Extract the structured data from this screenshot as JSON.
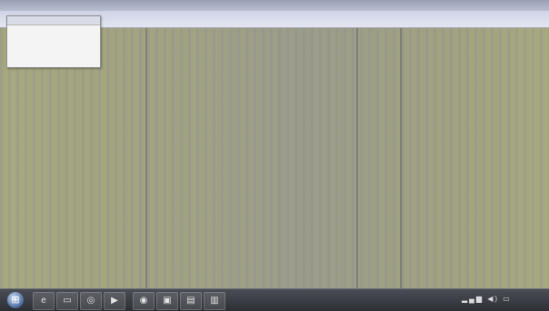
{
  "window": {
    "title": "",
    "menu_label": ""
  },
  "popup": {
    "header": "",
    "rows": [
      {
        "key": "",
        "value": ""
      },
      {
        "key": "",
        "value": ""
      },
      {
        "key": "",
        "value": ""
      },
      {
        "key": "",
        "value": ""
      }
    ]
  },
  "taskbar": {
    "start_icon": "windows-orb",
    "pinned": [
      {
        "icon": "internet-explorer-icon",
        "glyph": "e"
      },
      {
        "icon": "folder-icon",
        "glyph": "▭"
      },
      {
        "icon": "media-player-icon",
        "glyph": "◎"
      },
      {
        "icon": "app-icon",
        "glyph": "▶"
      },
      {
        "icon": "chrome-icon",
        "glyph": "◉"
      },
      {
        "icon": "app-icon-2",
        "glyph": "▣"
      },
      {
        "icon": "document-icon",
        "glyph": "▤"
      },
      {
        "icon": "terminal-icon",
        "glyph": "▥"
      }
    ],
    "tray_icons": [
      "network-icon",
      "volume-icon",
      "flag-icon",
      "battery-icon"
    ],
    "clock_time": "",
    "clock_date": ""
  }
}
